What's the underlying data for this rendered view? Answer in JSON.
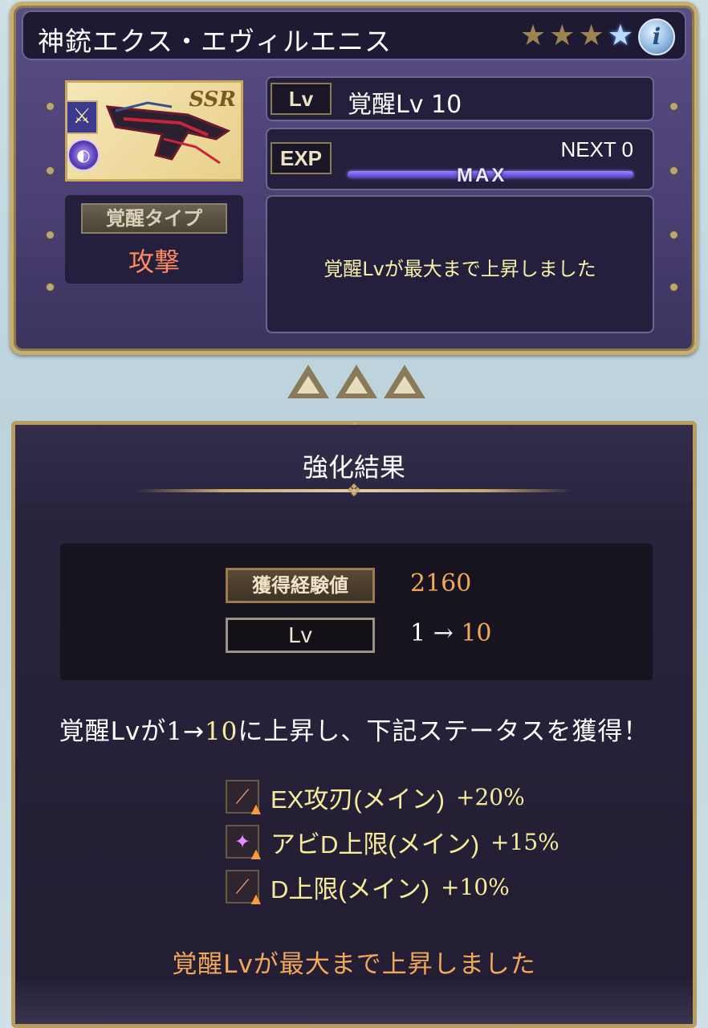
{
  "weapon": {
    "name": "神銃エクス・エヴィルエニス",
    "stars": [
      "star-gold",
      "star-gold",
      "star-gold",
      "star-blue"
    ],
    "info_icon": "info-icon",
    "rarity": "SSR",
    "type_icon": "crossed-swords-icon",
    "element_icon": "dark-element-icon",
    "awaken_type_label": "覚醒タイプ",
    "awaken_type_value": "攻撃"
  },
  "status": {
    "lv_tag": "Lv",
    "lv_value": "覚醒Lv 10",
    "exp_tag": "EXP",
    "next_label": "NEXT 0",
    "exp_bar_fill": 1.0,
    "max_label": "MAX",
    "message": "覚醒Lvが最大まで上昇しました"
  },
  "result": {
    "title": "強化結果",
    "exp_label": "獲得経験値",
    "exp_value": "2160",
    "lv_label": "Lv",
    "lv_from": "1",
    "lv_arrow": "→",
    "lv_to": "10",
    "summary_prefix": "覚醒Lvが",
    "summary_from": "1",
    "summary_arrow": "→",
    "summary_to": "10",
    "summary_suffix": "に上昇し、下記ステータスを獲得！",
    "bonuses": [
      {
        "icon": "sword-up-icon",
        "name": "EX攻刃(メイン)",
        "value": "+20%"
      },
      {
        "icon": "sparkle-up-icon",
        "name": "アビD上限(メイン)",
        "value": "+15%"
      },
      {
        "icon": "sword-up-icon",
        "name": "D上限(メイン)",
        "value": "+10%"
      }
    ],
    "footer": "覚醒Lvが最大まで上昇しました"
  },
  "colors": {
    "accent_gold": "#c8ad72",
    "awaken_type": "#ff8a5c",
    "highlight_orange": "#f2a85a",
    "bonus_yellow": "#f6ec9a",
    "exp_bar": "#7a5fe8"
  }
}
